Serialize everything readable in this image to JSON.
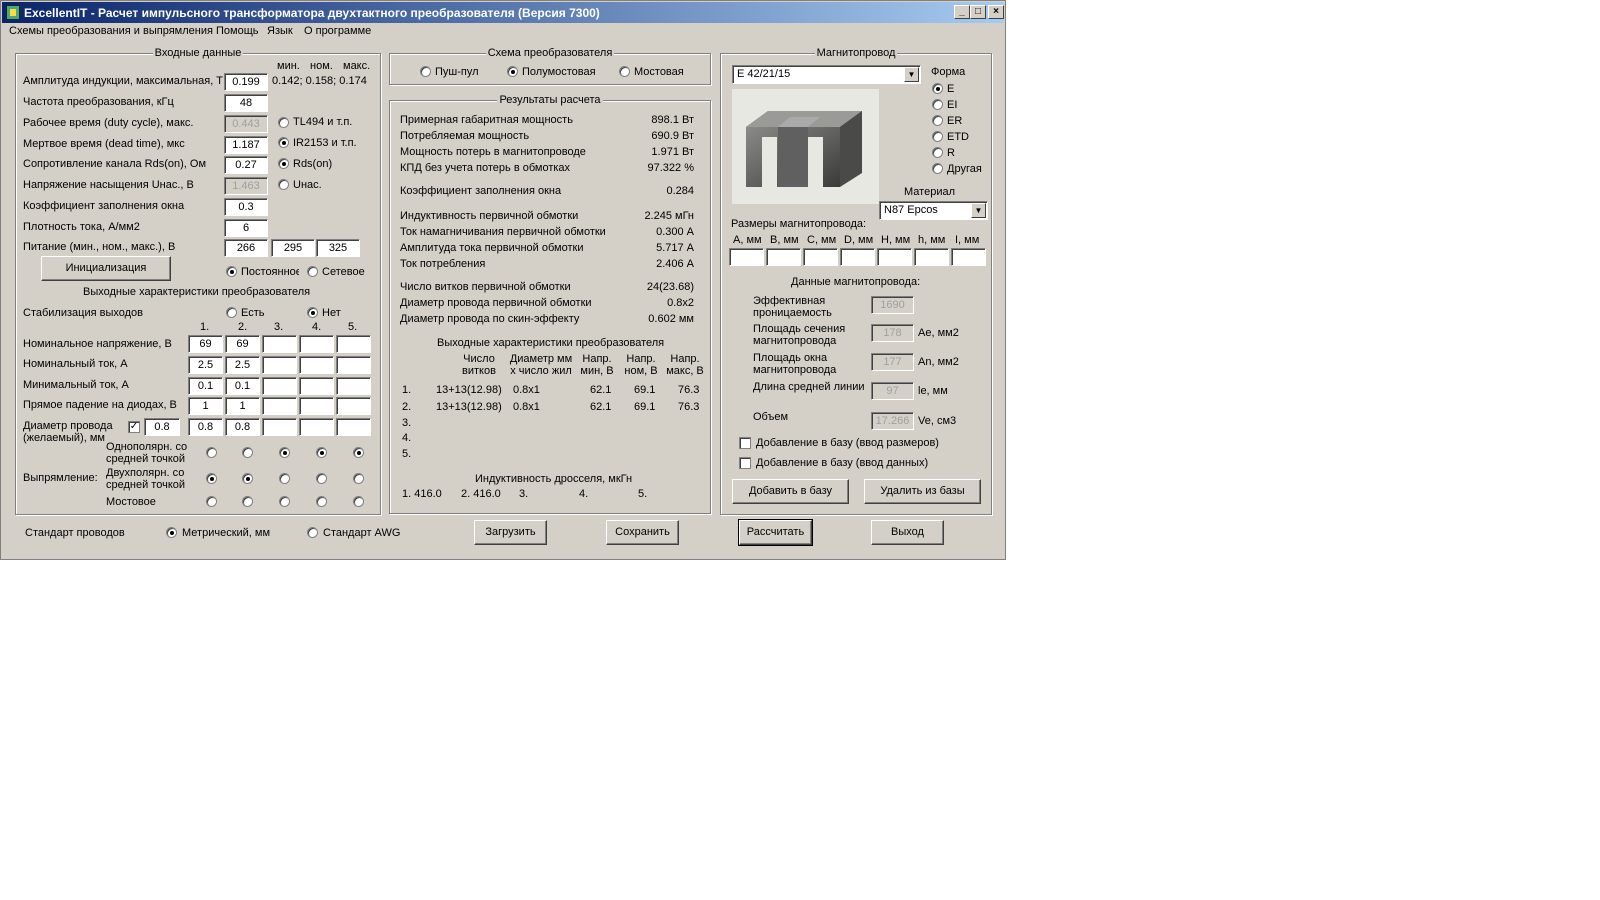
{
  "window": {
    "title": "ExcellentIT - Расчет импульсного трансформатора двухтактного преобразователя (Версия 7300)",
    "controls": [
      "_",
      "□",
      "×"
    ]
  },
  "menu": [
    "Схемы преобразования и выпрямления",
    "Помощь",
    "Язык",
    "О программе"
  ],
  "input": {
    "title": "Входные данные",
    "col_heads": [
      "мин.",
      "ном.",
      "макс."
    ],
    "rows": [
      {
        "label": "Амплитуда индукции, максимальная, Т",
        "value": "0.199",
        "extra": "0.142; 0.158; 0.174"
      },
      {
        "label": "Частота преобразования, кГц",
        "value": "48"
      },
      {
        "label": "Рабочее время (duty cycle), макс.",
        "value": "0.443"
      },
      {
        "label": "Мертвое время (dead time), мкс",
        "value": "1.187"
      },
      {
        "label": "Сопротивление канала Rds(on), Ом",
        "value": "0.27"
      },
      {
        "label": "Напряжение насыщения Uнас., В",
        "value": "1.463"
      },
      {
        "label": "Коэффициент заполнения окна",
        "value": "0.3"
      },
      {
        "label": "Плотность тока, А/мм2",
        "value": "6"
      },
      {
        "label": "Питание (мин., ном., макс.), В",
        "values": [
          "266",
          "295",
          "325"
        ]
      }
    ],
    "radios": [
      "TL494 и т.п.",
      "IR2153 и т.п.",
      "Rds(on)",
      "Uнас."
    ],
    "init_button": "Инициализация",
    "supply": [
      "Постоянное",
      "Сетевое"
    ]
  },
  "output": {
    "title": "Выходные характеристики преобразователя",
    "stab_label": "Стабилизация выходов",
    "stab_opts": [
      "Есть",
      "Нет"
    ],
    "cols": [
      "1.",
      "2.",
      "3.",
      "4.",
      "5."
    ],
    "rows": [
      {
        "label": "Номинальное напряжение, В",
        "values": [
          "69",
          "69",
          "",
          "",
          ""
        ]
      },
      {
        "label": "Номинальный ток, А",
        "values": [
          "2.5",
          "2.5",
          "",
          "",
          ""
        ]
      },
      {
        "label": "Минимальный ток, А",
        "values": [
          "0.1",
          "0.1",
          "",
          "",
          ""
        ]
      },
      {
        "label": "Прямое падение на диодах, В",
        "values": [
          "1",
          "1",
          "",
          "",
          ""
        ]
      },
      {
        "label": "Диаметр провода (желаемый), мм",
        "check": "✓",
        "check_value": "0.8",
        "values": [
          "0.8",
          "0.8",
          "",
          "",
          ""
        ]
      }
    ],
    "rect_label": "Выпрямление:",
    "rect_opts": [
      {
        "label": "Однополярн. со средней точкой",
        "sel": [
          false,
          false,
          true,
          true,
          true
        ]
      },
      {
        "label": "Двухполярн. со средней точкой",
        "sel": [
          true,
          true,
          false,
          false,
          false
        ]
      },
      {
        "label": "Мостовое",
        "sel": [
          false,
          false,
          false,
          false,
          false
        ]
      }
    ]
  },
  "scheme": {
    "title": "Схема преобразователя",
    "opts": [
      "Пуш-пул",
      "Полумостовая",
      "Мостовая"
    ],
    "selected": 1
  },
  "results": {
    "title": "Результаты расчета",
    "rows": [
      {
        "label": "Примерная габаритная мощность",
        "value": "898.1 Вт"
      },
      {
        "label": "Потребляемая мощность",
        "value": "690.9 Вт"
      },
      {
        "label": "Мощность потерь в магнитопроводе",
        "value": "1.971 Вт"
      },
      {
        "label": "КПД без учета потерь в обмотках",
        "value": "97.322 %"
      },
      {
        "label": "Коэффициент заполнения окна",
        "value": "0.284"
      },
      {
        "label": "Индуктивность первичной обмотки",
        "value": "2.245 мГн"
      },
      {
        "label": "Ток намагничивания первичной обмотки",
        "value": "0.300 А"
      },
      {
        "label": "Амплитуда тока первичной обмотки",
        "value": "5.717 А"
      },
      {
        "label": "Ток потребления",
        "value": "2.406 А"
      },
      {
        "label": "Число витков первичной обмотки",
        "value": "24(23.68)"
      },
      {
        "label": "Диаметр провода первичной обмотки",
        "value": "0.8x2"
      },
      {
        "label": "Диаметр провода по скин-эффекту",
        "value": "0.602 мм"
      }
    ],
    "out_title": "Выходные характеристики преобразователя",
    "out_heads": [
      "Число витков",
      "Диаметр мм х число жил",
      "Напр. мин, В",
      "Напр. ном, В",
      "Напр. макс, В"
    ],
    "out_rows": [
      {
        "n": "1.",
        "turns": "13+13(12.98)",
        "wire": "0.8x1",
        "umin": "62.1",
        "unom": "69.1",
        "umax": "76.3"
      },
      {
        "n": "2.",
        "turns": "13+13(12.98)",
        "wire": "0.8x1",
        "umin": "62.1",
        "unom": "69.1",
        "umax": "76.3"
      },
      {
        "n": "3."
      },
      {
        "n": "4."
      },
      {
        "n": "5."
      }
    ],
    "choke_title": "Индуктивность дросселя, мкГн",
    "choke": [
      "1. 416.0",
      "2. 416.0",
      "3.",
      "4.",
      "5."
    ]
  },
  "core": {
    "title": "Магнитопровод",
    "selected": "E 42/21/15",
    "form_label": "Форма",
    "forms": [
      "E",
      "EI",
      "ER",
      "ETD",
      "R",
      "Другая"
    ],
    "form_selected": 0,
    "material_label": "Материал",
    "material": "N87 Epcos",
    "dims_label": "Размеры магнитопровода:",
    "dims": [
      "A, мм",
      "B, мм",
      "C, мм",
      "D, мм",
      "H, мм",
      "h, мм",
      "I, мм"
    ],
    "data_label": "Данные магнитопровода:",
    "data": [
      {
        "label": "Эффективная проницаемость",
        "value": "1690",
        "unit": ""
      },
      {
        "label": "Площадь сечения магнитопровода",
        "value": "178",
        "unit": "Ae, мм2"
      },
      {
        "label": "Площадь окна магнитопровода",
        "value": "177",
        "unit": "An, мм2"
      },
      {
        "label": "Длина средней линии",
        "value": "97",
        "unit": "le, мм"
      },
      {
        "label": "Объем",
        "value": "17.266",
        "unit": "Ve, см3"
      }
    ],
    "chk1": "Добавление в базу (ввод размеров)",
    "chk2": "Добавление в базу (ввод данных)",
    "add": "Добавить в базу",
    "del": "Удалить из базы"
  },
  "bottom": {
    "std_label": "Стандарт проводов",
    "metric": "Метрический, мм",
    "awg": "Стандарт AWG",
    "load": "Загрузить",
    "save": "Сохранить",
    "calc": "Рассчитать",
    "exit": "Выход"
  }
}
